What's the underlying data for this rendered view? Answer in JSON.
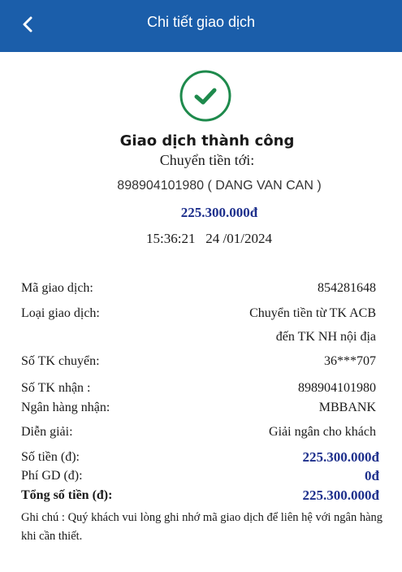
{
  "header": {
    "title": "Chi tiết giao dịch",
    "back_icon": "chevron-left-icon"
  },
  "status": {
    "icon": "check-circle-icon",
    "text": "Giao dịch thành công",
    "accent": "#1e8a4c"
  },
  "summary": {
    "transfer_to_label": "Chuyển tiền tới:",
    "recipient": "898904101980 ( DANG VAN CAN )",
    "amount": "225.300.000đ",
    "time": "15:36:21   24 /01/2024"
  },
  "details": {
    "txn_id_label": "Mã giao dịch:",
    "txn_id": "854281648",
    "txn_type_label": "Loại giao dịch:",
    "txn_type_line1": "Chuyển tiền từ TK ACB",
    "txn_type_line2": "đến TK NH nội địa",
    "from_acct_label": "Số TK chuyển:",
    "from_acct": "36***707",
    "to_acct_label": "Số TK nhận :",
    "to_acct": "898904101980",
    "bank_label": "Ngân hàng nhận:",
    "bank": "MBBANK",
    "desc_label": "Diễn giải:",
    "desc": "Giải ngân cho khách",
    "amount_label": "Số tiền (đ):",
    "amount": "225.300.000đ",
    "fee_label": "Phí GD (đ):",
    "fee": "0đ",
    "total_label": "Tổng số tiền (đ):",
    "total": "225.300.000đ"
  },
  "note": "Ghi chú : Quý khách vui lòng ghi nhớ mã giao dịch để liên hệ với ngân hàng khi cần thiết.",
  "colors": {
    "header": "#1b5eaa",
    "amount": "#1d2f8c",
    "success": "#1e8a4c"
  }
}
